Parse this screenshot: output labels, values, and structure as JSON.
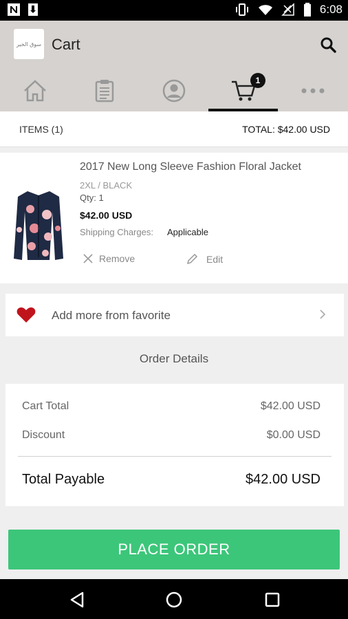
{
  "status_bar": {
    "time": "6:08"
  },
  "app_bar": {
    "title": "Cart",
    "logo_text": "سوق الخير"
  },
  "tabs": [
    {
      "name": "home-icon"
    },
    {
      "name": "orders-icon"
    },
    {
      "name": "profile-icon"
    },
    {
      "name": "cart-icon",
      "badge": "1",
      "active": true
    },
    {
      "name": "more-icon"
    }
  ],
  "summary": {
    "items": "ITEMS (1)",
    "total": "TOTAL: $42.00 USD"
  },
  "cart_item": {
    "name": "2017 New Long Sleeve Fashion Floral Jacket",
    "variant": "2XL / BLACK",
    "qty": "Qty: 1",
    "price": "$42.00 USD",
    "shipping_label": "Shipping Charges:",
    "shipping_value": "Applicable",
    "remove_label": "Remove",
    "edit_label": "Edit"
  },
  "favorites": {
    "label": "Add more from favorite"
  },
  "order_details": {
    "heading": "Order Details",
    "cart_total_label": "Cart Total",
    "cart_total_value": "$42.00 USD",
    "discount_label": "Discount",
    "discount_value": "$0.00 USD",
    "total_payable_label": "Total Payable",
    "total_payable_value": "$42.00 USD"
  },
  "place_order": {
    "label": "PLACE ORDER"
  },
  "colors": {
    "accent": "#3cc67a",
    "header_bg": "#d5d2cf",
    "heart": "#c0141c"
  }
}
